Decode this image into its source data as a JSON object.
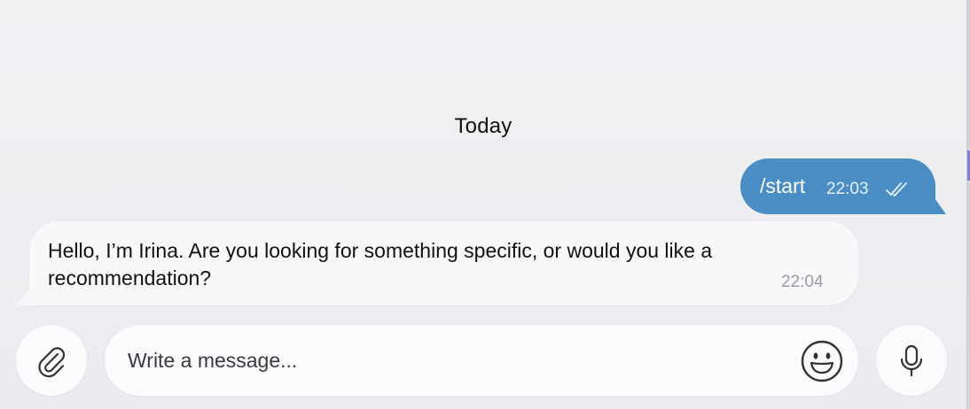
{
  "chat": {
    "date_divider": "Today",
    "messages": [
      {
        "direction": "outgoing",
        "text": "/start",
        "time": "22:03",
        "status": "read",
        "status_icon": "double-check-icon"
      },
      {
        "direction": "incoming",
        "text": "Hello, I’m Irina. Are you looking for something specific, or would you like a recommendation?",
        "time": "22:04"
      }
    ]
  },
  "composer": {
    "placeholder": "Write a message...",
    "value": "",
    "attach_icon": "paperclip-icon",
    "emoji_icon": "smile-icon",
    "mic_icon": "microphone-icon"
  },
  "colors": {
    "outgoing_bubble": "#4b8ec6",
    "incoming_bubble": "#f8f8fa",
    "background": "#eeeef2",
    "timestamp_incoming": "#9a9aa0"
  }
}
